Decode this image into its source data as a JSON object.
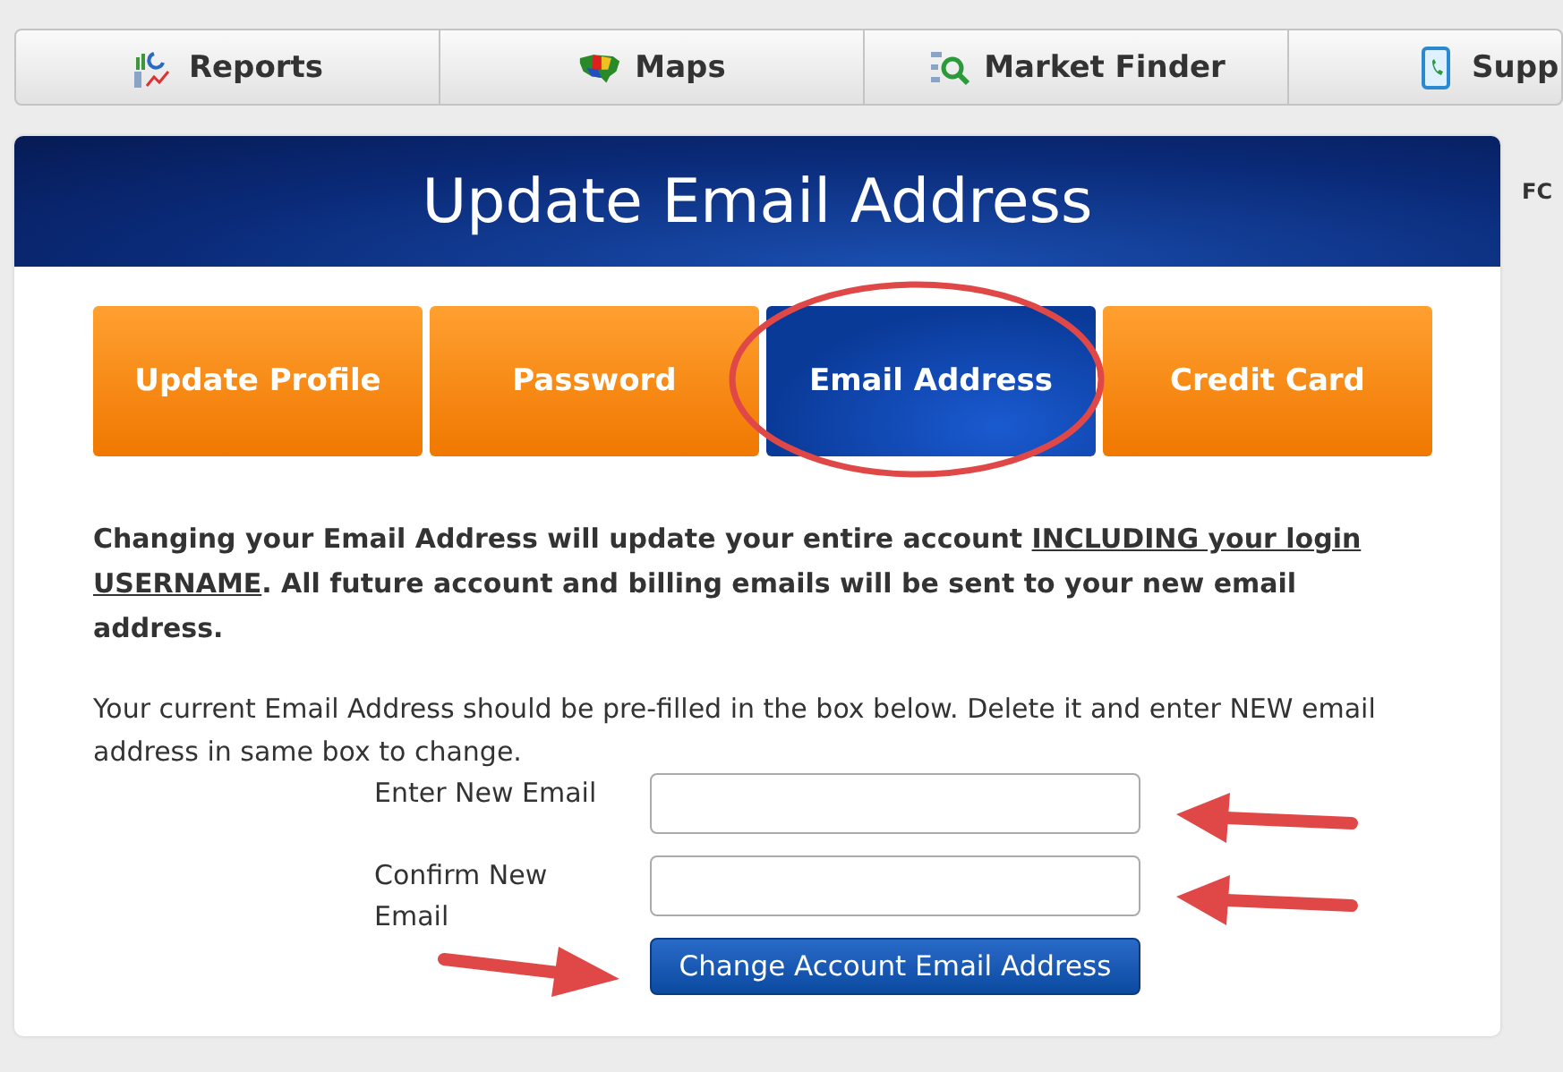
{
  "nav": [
    {
      "label": "Reports"
    },
    {
      "label": "Maps"
    },
    {
      "label": "Market Finder"
    },
    {
      "label": "Supp"
    }
  ],
  "side_text": "FC",
  "panel": {
    "title": "Update Email Address"
  },
  "tabs": [
    {
      "label": "Update Profile",
      "selected": false
    },
    {
      "label": "Password",
      "selected": false
    },
    {
      "label": "Email Address",
      "selected": true
    },
    {
      "label": "Credit Card",
      "selected": false
    }
  ],
  "notice": [
    {
      "text": "Changing your Email Address will update your entire account ",
      "underline": false
    },
    {
      "text": "INCLUDING your login USERNAME",
      "underline": true
    },
    {
      "text": ". All future account and billing emails will be sent to your new email address.",
      "underline": false
    }
  ],
  "info": "Your current Email Address should be pre-filled in the box below. Delete it and enter NEW email address in same box to change.",
  "fields": [
    {
      "label": "Enter New Email"
    },
    {
      "label": "Confirm New Email"
    }
  ],
  "submit": "Change Account Email Address"
}
